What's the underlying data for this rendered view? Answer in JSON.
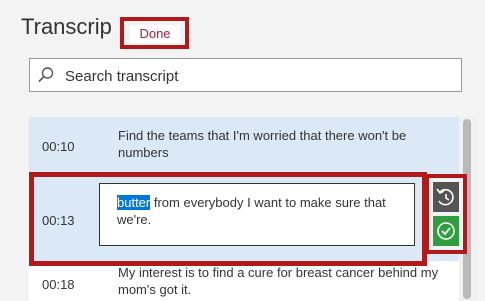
{
  "panel": {
    "title": "Transcrip",
    "done_label": "Done"
  },
  "search": {
    "placeholder": "Search transcript",
    "value": ""
  },
  "transcript": [
    {
      "time": "00:10",
      "text": "Find the teams that I'm worried that there won't be numbers"
    },
    {
      "time": "00:13",
      "highlight": "butter",
      "text": " from everybody I want to make sure that we're."
    },
    {
      "time": "00:18",
      "text": "My interest is to find a cure for breast cancer behind my mom's got it."
    }
  ],
  "icons": {
    "search": "search-icon",
    "revert": "revert-icon",
    "accept": "checkmark-icon"
  },
  "colors": {
    "annotation": "#b11a1a",
    "accept": "#2e9e3e",
    "selection": "#0078d7",
    "done_text": "#b01a3c"
  }
}
